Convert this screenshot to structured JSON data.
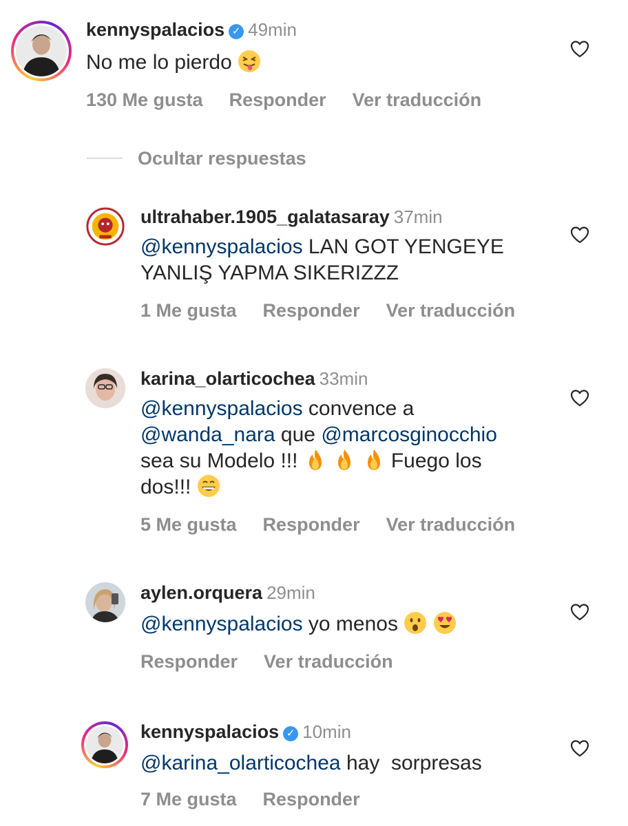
{
  "thread": {
    "parent": {
      "username": "kennyspalacios",
      "verified": true,
      "time": "49min",
      "text": "No me lo pierdo",
      "emoji": "squinting-tongue",
      "likes": "130 Me gusta",
      "reply": "Responder",
      "translate": "Ver traducción"
    },
    "hide_replies": "Ocultar respuestas",
    "replies": [
      {
        "username": "ultrahaber.1905_galatasaray",
        "time": "37min",
        "mention": "@kennyspalacios",
        "text_line1": " LAN GOT YENGEYE",
        "text_line2": "YANLIŞ YAPMA SIKERIZZZ",
        "likes": "1 Me gusta",
        "reply": "Responder",
        "translate": "Ver traducción"
      },
      {
        "username": "karina_olarticochea",
        "time": "33min",
        "mention1": "@kennyspalacios",
        "text1": " convence a",
        "mention2": "@wanda_nara",
        "text2": " que ",
        "mention3": "@marcosginocchio",
        "text3": "sea su Modelo !!!",
        "text4": "Fuego los",
        "text5": "dos!!!",
        "likes": "5 Me gusta",
        "reply": "Responder",
        "translate": "Ver traducción"
      },
      {
        "username": "aylen.orquera",
        "time": "29min",
        "mention": "@kennyspalacios",
        "text": " yo menos",
        "reply": "Responder",
        "translate": "Ver traducción"
      },
      {
        "username": "kennyspalacios",
        "verified": true,
        "time": "10min",
        "mention": "@karina_olarticochea",
        "text": " hay  sorpresas",
        "likes": "7 Me gusta",
        "reply": "Responder"
      }
    ]
  },
  "icons": {
    "heart": "heart-outline-icon",
    "verified": "verified-badge-icon"
  },
  "colors": {
    "mention": "#00376b",
    "muted": "#8e8e8e",
    "verified": "#3897f0"
  }
}
